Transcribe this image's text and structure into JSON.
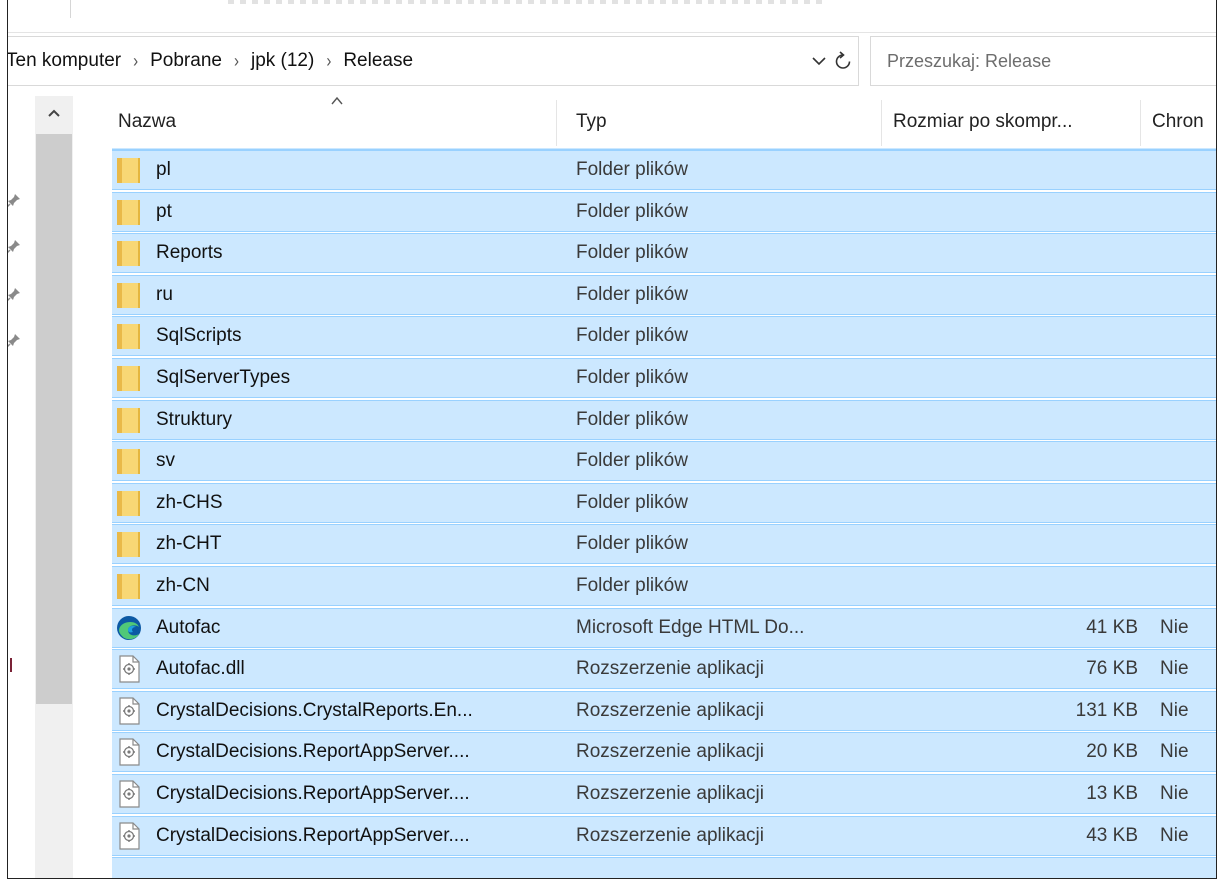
{
  "breadcrumb": {
    "items": [
      "Ten komputer",
      "Pobrane",
      "jpk (12)",
      "Release"
    ]
  },
  "search": {
    "placeholder": "Przeszukaj: Release"
  },
  "columns": {
    "name": "Nazwa",
    "type": "Typ",
    "size": "Rozmiar po skompr...",
    "compressed": "Chron"
  },
  "files": [
    {
      "name": "pl",
      "type": "Folder plików",
      "size": "",
      "compressed": "",
      "icon": "folder-icon"
    },
    {
      "name": "pt",
      "type": "Folder plików",
      "size": "",
      "compressed": "",
      "icon": "folder-icon"
    },
    {
      "name": "Reports",
      "type": "Folder plików",
      "size": "",
      "compressed": "",
      "icon": "folder-icon"
    },
    {
      "name": "ru",
      "type": "Folder plików",
      "size": "",
      "compressed": "",
      "icon": "folder-icon"
    },
    {
      "name": "SqlScripts",
      "type": "Folder plików",
      "size": "",
      "compressed": "",
      "icon": "folder-icon"
    },
    {
      "name": "SqlServerTypes",
      "type": "Folder plików",
      "size": "",
      "compressed": "",
      "icon": "folder-icon"
    },
    {
      "name": "Struktury",
      "type": "Folder plików",
      "size": "",
      "compressed": "",
      "icon": "folder-icon"
    },
    {
      "name": "sv",
      "type": "Folder plików",
      "size": "",
      "compressed": "",
      "icon": "folder-icon"
    },
    {
      "name": "zh-CHS",
      "type": "Folder plików",
      "size": "",
      "compressed": "",
      "icon": "folder-icon"
    },
    {
      "name": "zh-CHT",
      "type": "Folder plików",
      "size": "",
      "compressed": "",
      "icon": "folder-icon"
    },
    {
      "name": "zh-CN",
      "type": "Folder plików",
      "size": "",
      "compressed": "",
      "icon": "folder-icon"
    },
    {
      "name": "Autofac",
      "type": "Microsoft Edge HTML Do...",
      "size": "41 KB",
      "compressed": "Nie",
      "icon": "edge-icon"
    },
    {
      "name": "Autofac.dll",
      "type": "Rozszerzenie aplikacji",
      "size": "76 KB",
      "compressed": "Nie",
      "icon": "dll-icon"
    },
    {
      "name": "CrystalDecisions.CrystalReports.En...",
      "type": "Rozszerzenie aplikacji",
      "size": "131 KB",
      "compressed": "Nie",
      "icon": "dll-icon"
    },
    {
      "name": "CrystalDecisions.ReportAppServer....",
      "type": "Rozszerzenie aplikacji",
      "size": "20 KB",
      "compressed": "Nie",
      "icon": "dll-icon"
    },
    {
      "name": "CrystalDecisions.ReportAppServer....",
      "type": "Rozszerzenie aplikacji",
      "size": "13 KB",
      "compressed": "Nie",
      "icon": "dll-icon"
    },
    {
      "name": "CrystalDecisions.ReportAppServer....",
      "type": "Rozszerzenie aplikacji",
      "size": "43 KB",
      "compressed": "Nie",
      "icon": "dll-icon"
    }
  ],
  "colors": {
    "selection": "#cce8ff",
    "selection_border": "#99d1ff",
    "folder": "#f8d775",
    "edge_blue": "#0c59a4",
    "edge_green": "#50c878"
  }
}
